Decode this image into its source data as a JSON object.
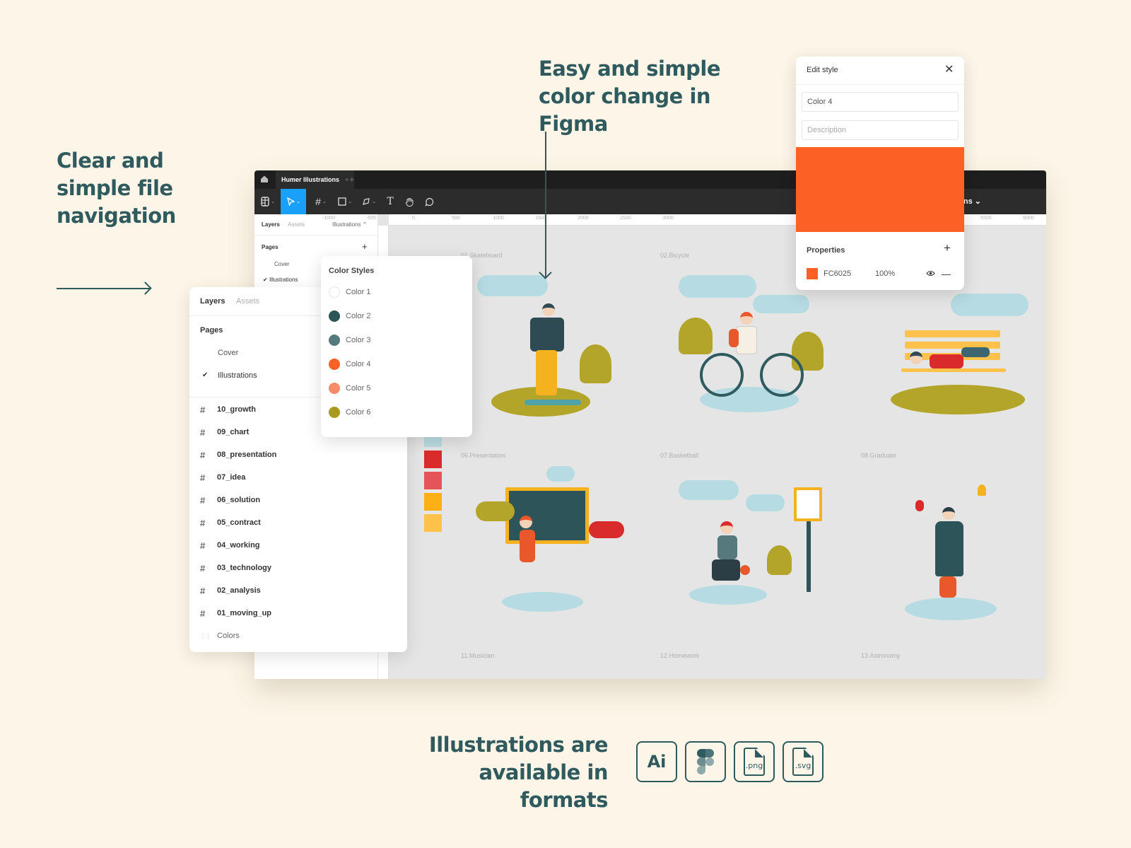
{
  "headlines": {
    "left": "Clear and simple file navigation",
    "top": "Easy and simple color change in Figma",
    "bottom": "Illustrations are available in formats"
  },
  "figma": {
    "tab_title": "Humer Illustrations",
    "tab_close": "×",
    "tab_add": "+",
    "toolbar_right": "ns ⌄",
    "tools": [
      "figma-menu",
      "move",
      "frame",
      "shape",
      "pen",
      "text",
      "hand",
      "comment"
    ],
    "ruler_ticks": [
      "-1000",
      "-500",
      "0",
      "500",
      "1000",
      "1500",
      "2000",
      "2500",
      "3000",
      "5500",
      "6000"
    ],
    "left_panel": {
      "layers_tab": "Layers",
      "assets_tab": "Assets",
      "page_selector": "Illustrations ⌃",
      "pages_label": "Pages",
      "add": "+",
      "pages": [
        "Cover",
        "Illustrations"
      ]
    },
    "frames": [
      {
        "label": "01.Skateboard"
      },
      {
        "label": "02.Bicycle"
      },
      {
        "label": "06.Presentation"
      },
      {
        "label": "07.Basketball"
      },
      {
        "label": "08.Graduate"
      },
      {
        "label": "11.Musician"
      },
      {
        "label": "12.Homework"
      },
      {
        "label": "13.Astronomy"
      }
    ],
    "swatch_colors": [
      "#b9dbe2",
      "#d92b2b",
      "#e45458",
      "#fdb016",
      "#fdc24a"
    ]
  },
  "layers_panel": {
    "layers_tab": "Layers",
    "assets_tab": "Assets",
    "pages_label": "Pages",
    "pages": [
      {
        "name": "Cover",
        "checked": false
      },
      {
        "name": "Illustrations",
        "checked": true
      }
    ],
    "check_glyph": "✔",
    "layers": [
      {
        "name": "10_growth",
        "type": "frame"
      },
      {
        "name": "09_chart",
        "type": "frame"
      },
      {
        "name": "08_presentation",
        "type": "frame"
      },
      {
        "name": "07_idea",
        "type": "frame"
      },
      {
        "name": "06_solution",
        "type": "frame"
      },
      {
        "name": "05_contract",
        "type": "frame"
      },
      {
        "name": "04_working",
        "type": "frame"
      },
      {
        "name": "03_technology",
        "type": "frame"
      },
      {
        "name": "02_analysis",
        "type": "frame"
      },
      {
        "name": "01_moving_up",
        "type": "frame"
      },
      {
        "name": "Colors",
        "type": "group"
      }
    ]
  },
  "color_styles": {
    "title": "Color Styles",
    "items": [
      {
        "name": "Color 1",
        "color": "#ffffff"
      },
      {
        "name": "Color 2",
        "color": "#2c5459"
      },
      {
        "name": "Color 3",
        "color": "#55797c"
      },
      {
        "name": "Color 4",
        "color": "#fc6025"
      },
      {
        "name": "Color 5",
        "color": "#f48c6a"
      },
      {
        "name": "Color 6",
        "color": "#a89a1e"
      }
    ]
  },
  "edit_style": {
    "title": "Edit style",
    "close": "✕",
    "name_value": "Color 4",
    "description_placeholder": "Description",
    "swatch_color": "#FC6025",
    "properties_label": "Properties",
    "add": "+",
    "fill": {
      "hex": "FC6025",
      "opacity": "100%",
      "eye": "👁",
      "remove": "—"
    }
  },
  "formats": {
    "ai": "Ai",
    "png": ".png",
    "svg": ".svg"
  },
  "colors": {
    "accent_text": "#2f5a5e",
    "background": "#fdf6e8",
    "figma_blue": "#18a0fb"
  }
}
